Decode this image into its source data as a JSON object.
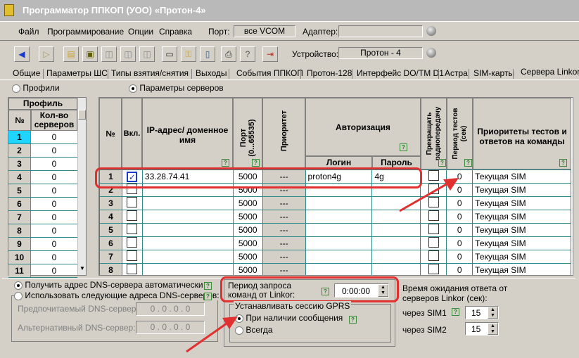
{
  "window": {
    "title": "Программатор ППКОП (УОО) «Протон-4»"
  },
  "menu": {
    "items": [
      "Файл",
      "Программирование",
      "Опции",
      "Справка"
    ],
    "port_label": "Порт:",
    "port_value": "все VCOM",
    "adapter_label": "Адаптер:",
    "adapter_value": ""
  },
  "toolbar": {
    "device_label": "Устройство:",
    "device_value": "Протон - 4"
  },
  "tabs": [
    "Общие",
    "Параметры ШС",
    "Типы взятия/снятия",
    "Выходы",
    "События ППКОП",
    "Протон-128",
    "Интерфейс DO/TM D1",
    "Астра",
    "SIM-карты",
    "Сервера Linkor (С"
  ],
  "mode": {
    "profiles": "Профили",
    "servers": "Параметры серверов",
    "selected": "servers"
  },
  "profile_table": {
    "header": "Профиль",
    "col_num": "№",
    "col_count": "Кол-во серверов",
    "rows": [
      {
        "n": "1",
        "c": "0"
      },
      {
        "n": "2",
        "c": "0"
      },
      {
        "n": "3",
        "c": "0"
      },
      {
        "n": "4",
        "c": "0"
      },
      {
        "n": "5",
        "c": "0"
      },
      {
        "n": "6",
        "c": "0"
      },
      {
        "n": "7",
        "c": "0"
      },
      {
        "n": "8",
        "c": "0"
      },
      {
        "n": "9",
        "c": "0"
      },
      {
        "n": "10",
        "c": "0"
      },
      {
        "n": "11",
        "c": "0"
      }
    ]
  },
  "server_table": {
    "col_num": "№",
    "col_enabled": "Вкл.",
    "col_ip": "IP-адрес/ доменное имя",
    "col_port": "Порт (0...65535)",
    "col_priority": "Приоритет",
    "col_auth": "Авторизация",
    "col_login": "Логин",
    "col_password": "Пароль",
    "col_stop": "Прекращать радиопередачу",
    "col_period": "Период тестов (сек)",
    "col_priorities": "Приоритеты тестов и ответов на команды",
    "rows": [
      {
        "n": "1",
        "on": true,
        "ip": "33.28.74.41",
        "port": "5000",
        "pri": "---",
        "login": "proton4g",
        "pass": "4g",
        "period": "0",
        "prio": "Текущая SIM"
      },
      {
        "n": "2",
        "on": false,
        "ip": "",
        "port": "5000",
        "pri": "---",
        "login": "",
        "pass": "",
        "period": "0",
        "prio": "Текущая SIM"
      },
      {
        "n": "3",
        "on": false,
        "ip": "",
        "port": "5000",
        "pri": "---",
        "login": "",
        "pass": "",
        "period": "0",
        "prio": "Текущая SIM"
      },
      {
        "n": "4",
        "on": false,
        "ip": "",
        "port": "5000",
        "pri": "---",
        "login": "",
        "pass": "",
        "period": "0",
        "prio": "Текущая SIM"
      },
      {
        "n": "5",
        "on": false,
        "ip": "",
        "port": "5000",
        "pri": "---",
        "login": "",
        "pass": "",
        "period": "0",
        "prio": "Текущая SIM"
      },
      {
        "n": "6",
        "on": false,
        "ip": "",
        "port": "5000",
        "pri": "---",
        "login": "",
        "pass": "",
        "period": "0",
        "prio": "Текущая SIM"
      },
      {
        "n": "7",
        "on": false,
        "ip": "",
        "port": "5000",
        "pri": "---",
        "login": "",
        "pass": "",
        "period": "0",
        "prio": "Текущая SIM"
      },
      {
        "n": "8",
        "on": false,
        "ip": "",
        "port": "5000",
        "pri": "---",
        "login": "",
        "pass": "",
        "period": "0",
        "prio": "Текущая SIM"
      }
    ]
  },
  "dns": {
    "auto": "Получить адрес DNS-сервера автоматически",
    "manual": "Использовать следующие адреса DNS-серверов:",
    "preferred_label": "Предпочитаемый DNS-сервер:",
    "preferred_value": "0 . 0 . 0 . 0",
    "alt_label": "Альтернативный DNS-сервер:",
    "alt_value": "0 . 0 . 0 . 0"
  },
  "period_cmd": {
    "label": "Период запроса команд от Linkor:",
    "value": "0:00:00"
  },
  "gprs": {
    "label": "Устанавливать сессию GPRS",
    "on_message": "При наличии сообщения",
    "always": "Всегда"
  },
  "wait": {
    "label": "Время ожидания ответа от серверов Linkor (сек):",
    "sim1_label": "через SIM1",
    "sim1_value": "15",
    "sim2_label": "через SIM2",
    "sim2_value": "15"
  },
  "colors": {
    "accent": "#e03030",
    "grid": "#2e8b8b"
  }
}
